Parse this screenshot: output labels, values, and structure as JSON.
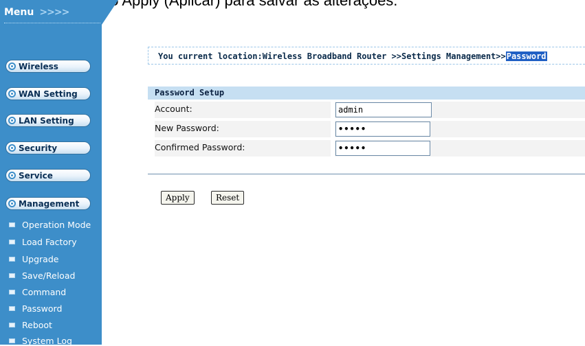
{
  "caption": "s, clique no botão Apply (Aplicar) para salvar as alterações.",
  "menu": {
    "title": "Menu",
    "arrows": ">>>>"
  },
  "sections": [
    {
      "label": "Wireless"
    },
    {
      "label": "WAN Setting"
    },
    {
      "label": "LAN Setting"
    },
    {
      "label": "Security"
    },
    {
      "label": "Service"
    },
    {
      "label": "Management"
    }
  ],
  "subitems": [
    {
      "label": "Operation Mode"
    },
    {
      "label": "Load Factory"
    },
    {
      "label": "Upgrade"
    },
    {
      "label": "Save/Reload"
    },
    {
      "label": "Command"
    },
    {
      "label": "Password"
    },
    {
      "label": "Reboot"
    },
    {
      "label": "System Log"
    }
  ],
  "breadcrumb": {
    "prefix": "You current location:Wireless Broadband Router >>Settings Management>>",
    "current": "Password"
  },
  "form": {
    "title": "Password Setup",
    "account": {
      "label": "Account:",
      "value": "admin"
    },
    "new_password": {
      "label": "New Password:",
      "value": "•••••"
    },
    "confirm_password": {
      "label": "Confirmed Password:",
      "value": "•••••"
    }
  },
  "buttons": {
    "apply": "Apply",
    "reset": "Reset"
  },
  "colors": {
    "sidebar": "#3d8ec9",
    "form_header": "#c6dff2",
    "highlight": "#1f5fc4"
  }
}
